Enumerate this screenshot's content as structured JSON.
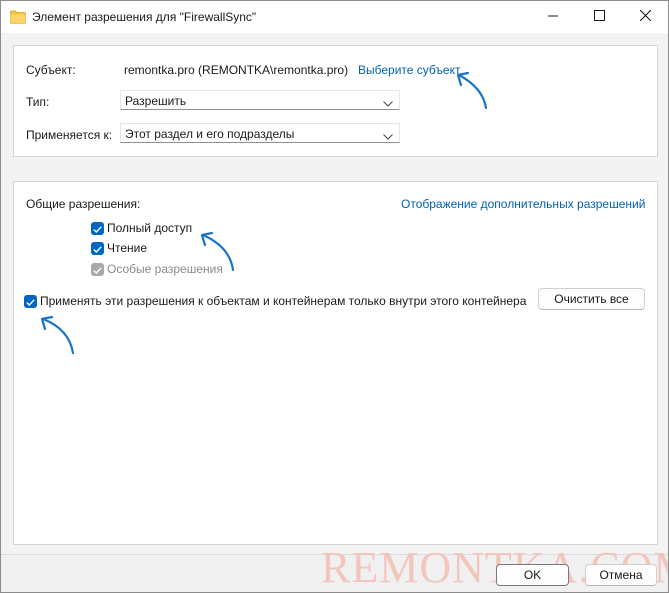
{
  "window": {
    "title": "Элемент разрешения для \"FirewallSync\"",
    "controls": {
      "minimize": "minimize-icon",
      "maximize": "maximize-icon",
      "close": "close-icon"
    }
  },
  "subject_section": {
    "subject_label": "Субъект:",
    "subject_value": "remontka.pro (REMONTKA\\remontka.pro)",
    "select_subject_link": "Выберите субъект",
    "type_label": "Тип:",
    "type_value": "Разрешить",
    "applies_label": "Применяется к:",
    "applies_value": "Этот раздел и его подразделы"
  },
  "permissions": {
    "heading": "Общие разрешения:",
    "advanced_link": "Отображение дополнительных разрешений",
    "items": [
      {
        "label": "Полный доступ",
        "checked": true,
        "enabled": true
      },
      {
        "label": "Чтение",
        "checked": true,
        "enabled": true
      },
      {
        "label": "Особые разрешения",
        "checked": true,
        "enabled": false
      }
    ],
    "apply_inside_label": "Применять эти разрешения к объектам и контейнерам только внутри этого контейнера",
    "apply_inside_checked": true,
    "clear_all_label": "Очистить все"
  },
  "footer": {
    "ok_label": "OK",
    "cancel_label": "Отмена"
  },
  "watermark": "REMONTKA.COM",
  "colors": {
    "accent": "#0067c0",
    "link": "#0062b1",
    "annotation_arrow": "#1a73c8",
    "watermark": "#f2beb4"
  }
}
